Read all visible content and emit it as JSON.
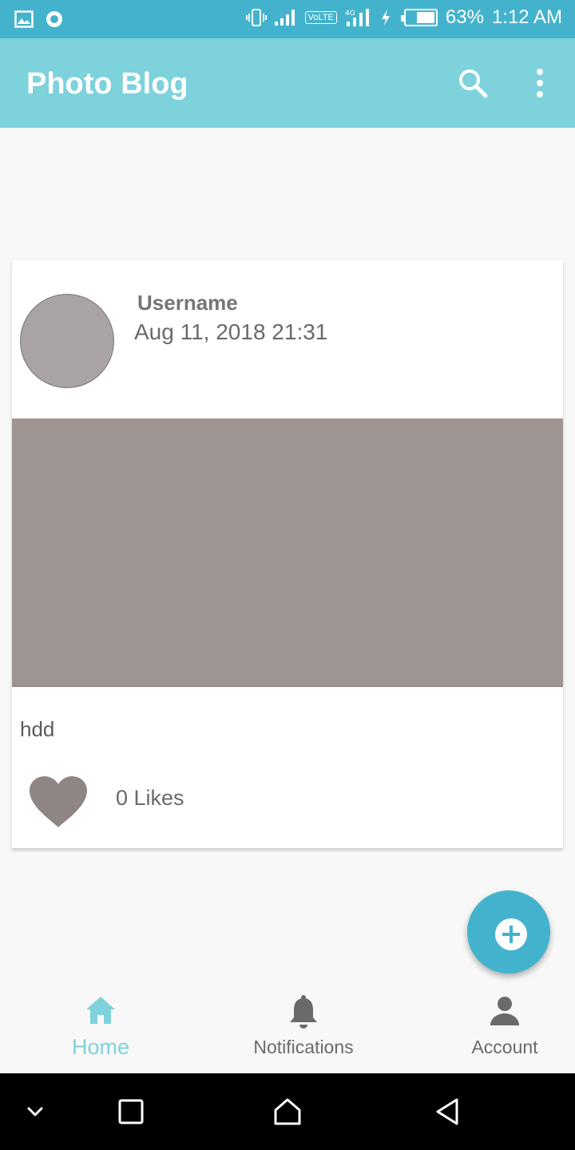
{
  "status_bar": {
    "battery_percent": "63%",
    "time": "1:12 AM",
    "network_tag": "VoLTE",
    "network_type": "4G",
    "battery_level": 0.63,
    "icons": [
      "gallery-notification-icon",
      "sync-notification-icon",
      "vibrate-icon",
      "signal-icon",
      "volte-icon",
      "4g-signal-icon",
      "charging-icon",
      "battery-icon"
    ]
  },
  "app_bar": {
    "title": "Photo Blog",
    "icons": [
      "search-icon",
      "more-vert-icon"
    ],
    "background": "#7dd2db"
  },
  "post": {
    "username": "Username",
    "date": "Aug 11, 2018 21:31",
    "description": "hdd",
    "likes_label": "0 Likes"
  },
  "fab": {
    "icon": "add-icon",
    "color": "#43b3cd"
  },
  "bottom_nav": {
    "items": [
      {
        "label": "Home",
        "icon": "home-icon",
        "active": true
      },
      {
        "label": "Notifications",
        "icon": "bell-icon",
        "active": false
      },
      {
        "label": "Account",
        "icon": "person-icon",
        "active": false
      }
    ],
    "active_color": "#7dd2db"
  },
  "system_nav": {
    "icons": [
      "chevron-down-icon",
      "recents-icon",
      "home-outline-icon",
      "back-icon"
    ]
  }
}
